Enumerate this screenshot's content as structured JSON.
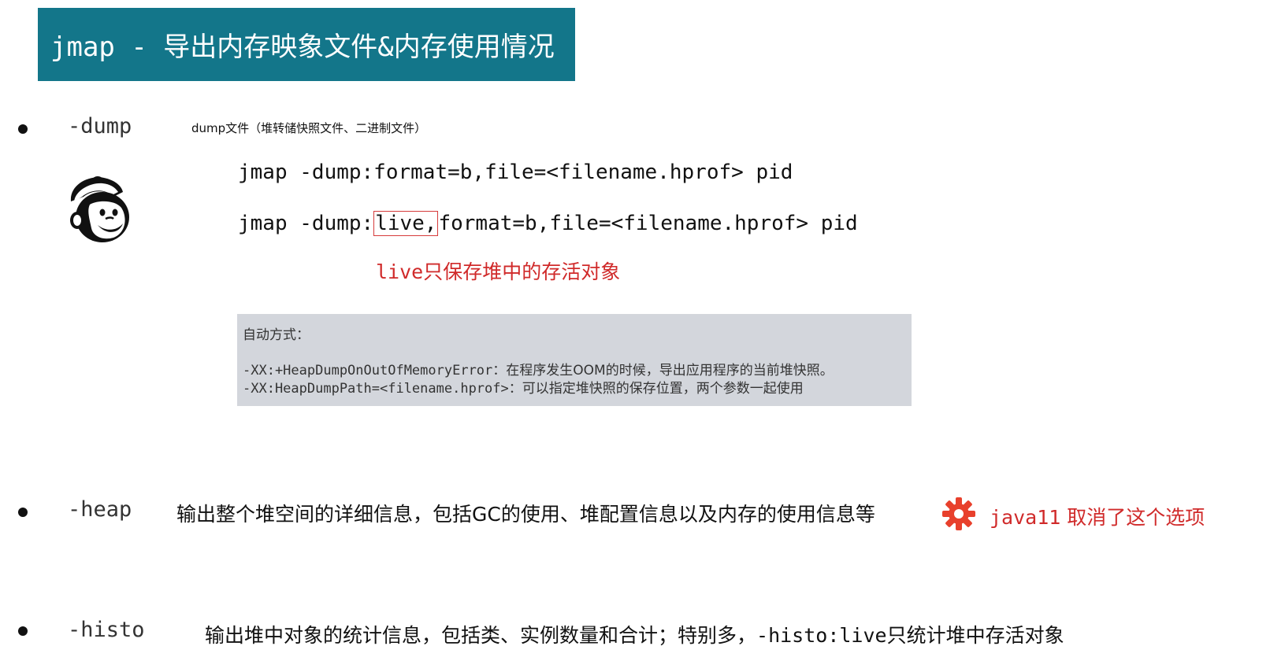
{
  "title": "jmap - 导出内存映象文件&内存使用情况",
  "dump": {
    "option": "-dump",
    "description": "dump文件（堆转储快照文件、二进制文件）",
    "cmd1": "jmap -dump:format=b,file=<filename.hprof> pid",
    "cmd2_prefix": "jmap -dump:",
    "cmd2_live": "live,",
    "cmd2_suffix": "format=b,file=<filename.hprof> pid",
    "live_note_keyword": "live",
    "live_note_text": "只保存堆中的存活对象",
    "mascot_icon": "chimp-mascot-icon"
  },
  "auto": {
    "heading": "自动方式：",
    "line1_flag": "-XX:+HeapDumpOnOutOfMemoryError",
    "line1_text": "：在程序发生OOM的时候，导出应用程序的当前堆快照。",
    "line2_flag": "-XX:HeapDumpPath=<filename.hprof>",
    "line2_text": "：可以指定堆快照的保存位置，两个参数一起使用"
  },
  "heap": {
    "option": "-heap",
    "description": "输出整个堆空间的详细信息，包括GC的使用、堆配置信息以及内存的使用信息等",
    "note_keyword": "java11",
    "note_text": " 取消了这个选项",
    "badge_icon": "red-gear-badge-icon"
  },
  "histo": {
    "option": "-histo",
    "description_a": "输出堆中对象的统计信息，包括类、实例数量和合计；特别多，",
    "description_cmd": "-histo:live",
    "description_b": "只统计堆中存活对象"
  },
  "colors": {
    "title_bg": "#13768a",
    "accent_red": "#d02a2a",
    "note_box_bg": "#d3d6dc"
  }
}
